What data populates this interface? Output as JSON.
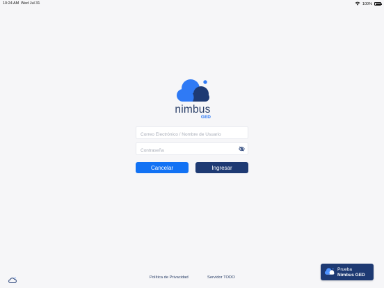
{
  "status_bar": {
    "time": "10:24 AM",
    "date": "Wed Jul 31",
    "battery": "100%",
    "battery_level": 1.0,
    "icons": [
      "wifi-icon",
      "battery-icon"
    ]
  },
  "logo": {
    "name": "nimbus",
    "subtitle": "GED",
    "colors": {
      "light_blue": "#2f7af5",
      "dark_blue": "#1e3a73",
      "word": "#2a3f68"
    }
  },
  "form": {
    "email_placeholder": "Correo Electrónico / Nombre de Usuario",
    "email_value": "",
    "password_placeholder": "Contraseña",
    "password_value": "",
    "password_toggle_icon": "eye-slash-icon",
    "cancel_label": "Cancelar",
    "login_label": "Ingresar"
  },
  "footer": {
    "app_icon": "cloud-icon",
    "privacy_label": "Política de Privacidad",
    "server_label": "Servidor TODO",
    "trial_line1": "Prueba",
    "trial_line2": "Nimbus GED"
  },
  "colors": {
    "background": "#f6f6f8",
    "primary": "#1272f4",
    "secondary": "#1e3a73"
  }
}
